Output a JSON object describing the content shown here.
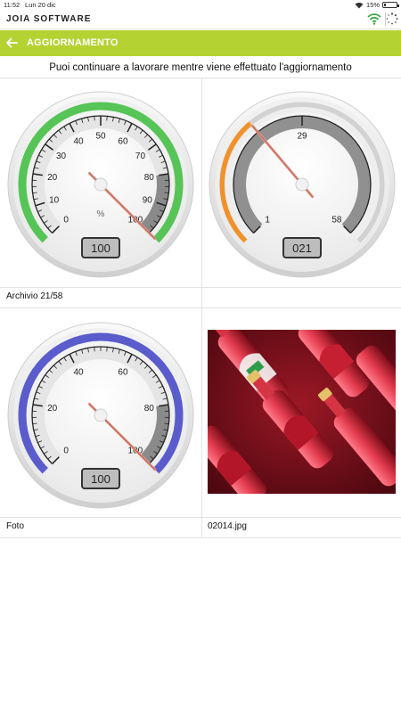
{
  "status": {
    "time": "11:52",
    "date": "Lun 20 dic",
    "battery": "15%",
    "battery_level": 0.15
  },
  "app": {
    "brand": "JOIA SOFTWARE"
  },
  "header": {
    "title": "AGGIORNAMENTO"
  },
  "notice": "Puoi continuare a lavorare mentre viene effettuato l'aggiornamento",
  "gauges": [
    {
      "id": "percent",
      "ticks": [
        "0",
        "10",
        "20",
        "30",
        "40",
        "50",
        "60",
        "70",
        "80",
        "90",
        "100"
      ],
      "unit": "%",
      "readout": "100",
      "value": 100,
      "min": 0,
      "max": 100,
      "arc_color": "#56c456"
    },
    {
      "id": "archive",
      "ticks": [
        "1",
        "29",
        "58"
      ],
      "readout": "021",
      "value": 21,
      "min": 1,
      "max": 58,
      "arc_color": "#f0922c"
    },
    {
      "id": "photo-progress",
      "ticks": [
        "0",
        "20",
        "40",
        "60",
        "80",
        "100"
      ],
      "readout": "100",
      "value": 100,
      "min": 0,
      "max": 100,
      "arc_color": "#5a5ccc"
    }
  ],
  "labels": {
    "archive": "Archivio 21/58",
    "photo": "Foto",
    "filename": "02014.jpg"
  },
  "colors": {
    "accent": "#b5d233",
    "green": "#56c456",
    "orange": "#f0922c",
    "blue": "#5a5ccc"
  }
}
